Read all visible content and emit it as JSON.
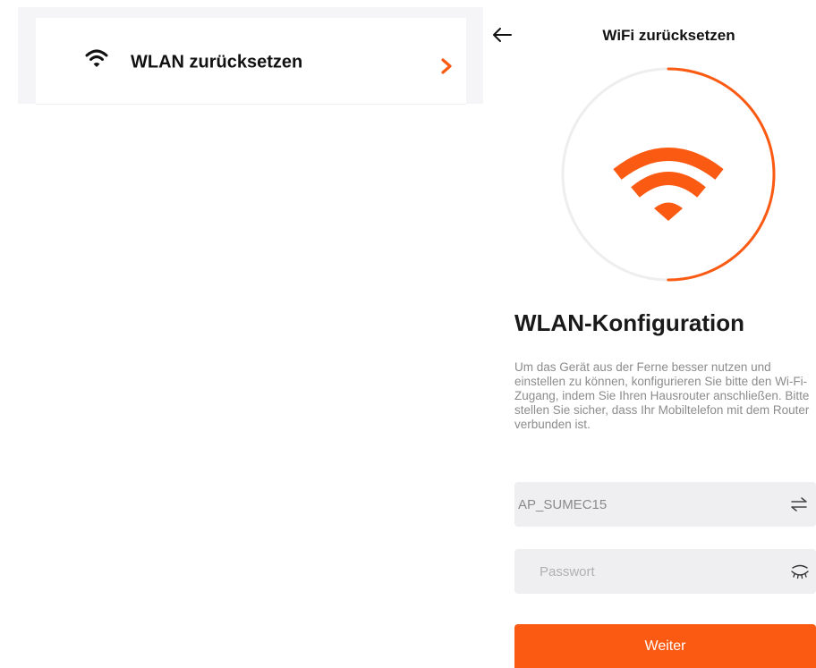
{
  "menu_card": {
    "label": "WLAN zurücksetzen",
    "icon": "wifi-icon",
    "chevron_icon": "chevron-right-icon"
  },
  "header": {
    "title": "WiFi zurücksetzen",
    "back_icon": "arrow-left-icon"
  },
  "progress": {
    "value": 0.5,
    "icon": "wifi-icon"
  },
  "config": {
    "heading": "WLAN-Konfiguration",
    "description": "Um das Gerät aus der Ferne besser nutzen und einstellen zu können, konfigurieren Sie bitte den Wi-Fi-Zugang, indem Sie Ihren Hausrouter anschließen. Bitte stellen Sie sicher, dass Ihr Mobiltelefon mit dem Router verbunden ist."
  },
  "form": {
    "ssid_value": "AP_SUMEC15",
    "ssid_icon": "switch-arrows-icon",
    "password_placeholder": "Passwort",
    "password_icon": "eye-closed-icon",
    "submit_label": "Weiter"
  },
  "colors": {
    "accent": "#fa5a12",
    "background": "#ffffff",
    "field_bg": "#efeff2",
    "text_muted": "#8c8c8c"
  }
}
